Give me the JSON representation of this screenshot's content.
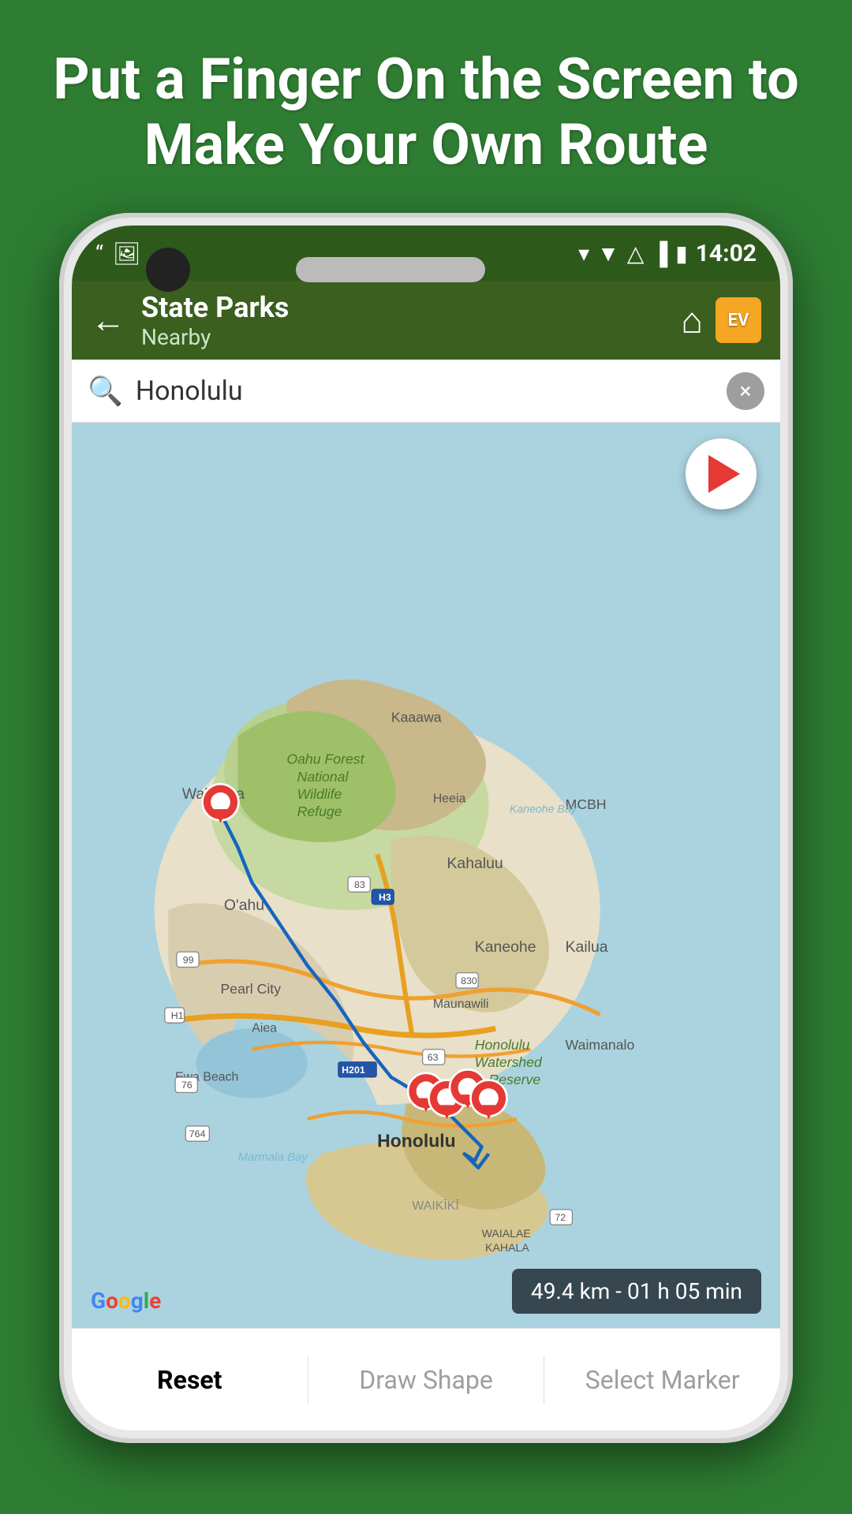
{
  "header": {
    "title": "Put a Finger On the Screen to Make Your Own Route"
  },
  "status_bar": {
    "icons_left": [
      "quote-icon",
      "image-icon"
    ],
    "icons_right": [
      "location-icon",
      "wifi-icon",
      "signal-icon",
      "signal-bars-icon",
      "battery-icon"
    ],
    "time": "14:02"
  },
  "toolbar": {
    "back_label": "←",
    "title": "State Parks",
    "subtitle": "Nearby",
    "home_icon": "home-icon",
    "ev_label": "EV"
  },
  "search": {
    "placeholder": "Honolulu",
    "value": "Honolulu",
    "close_label": "×"
  },
  "map": {
    "location_label": "Honolulu",
    "distance_badge": "49.4 km - 01 h 05 min"
  },
  "google_logo": {
    "text": "Google"
  },
  "bottom_bar": {
    "buttons": [
      {
        "label": "Reset",
        "active": true
      },
      {
        "label": "Draw Shape",
        "active": false
      },
      {
        "label": "Select Marker",
        "active": false
      }
    ]
  }
}
